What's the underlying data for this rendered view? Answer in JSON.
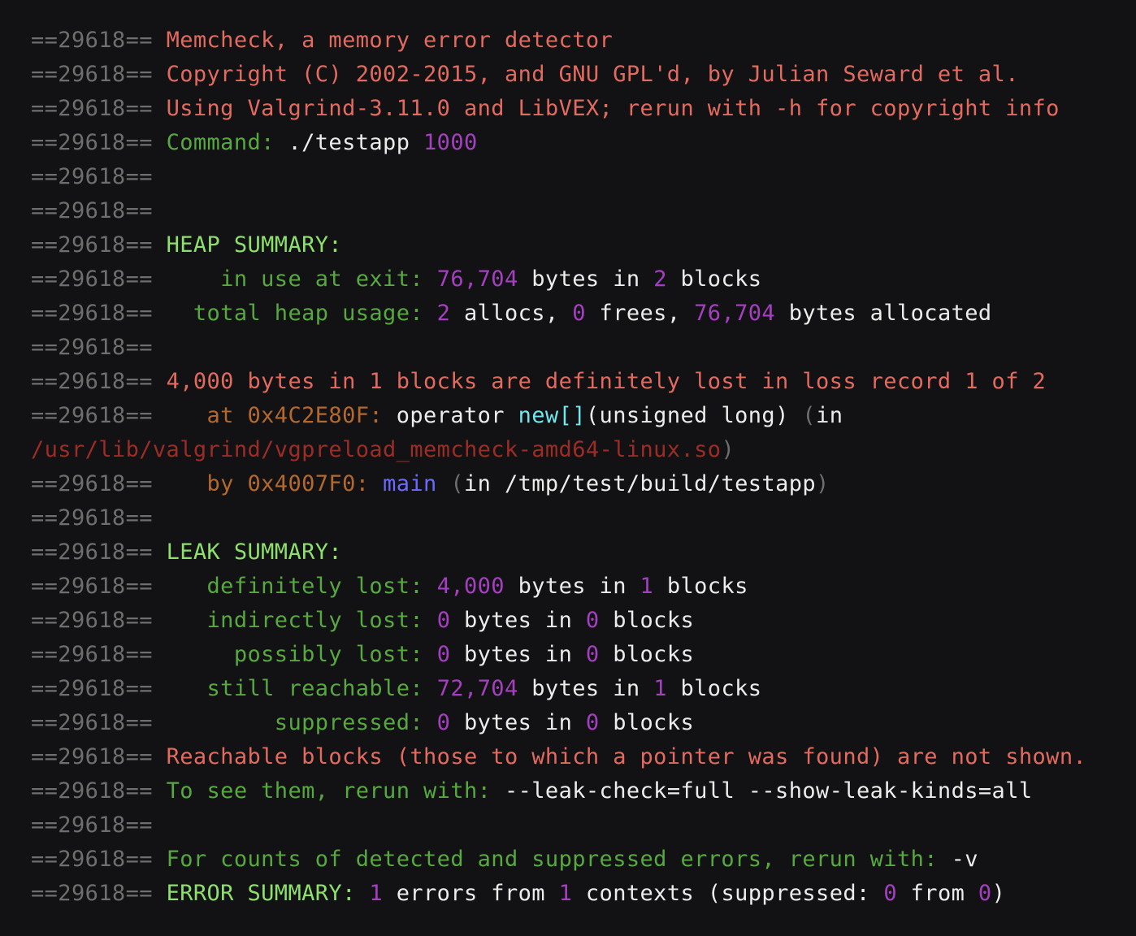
{
  "colors": {
    "background": "#121214",
    "pid": "#6e6e6e",
    "red": "#e26a5e",
    "green": "#56a83f",
    "bgreen": "#8ee06c",
    "purple": "#a43fbf",
    "white": "#ececec",
    "orange": "#b4682c",
    "cyan": "#6fe7ec",
    "blue": "#6a6aff",
    "darkred": "#9e2c26",
    "dim": "#6e6e6e"
  },
  "lines": [
    {
      "name": "line-tool-name",
      "segments": [
        {
          "t": "==29618== ",
          "c": "pid"
        },
        {
          "t": "Memcheck, a memory error detector",
          "c": "red"
        }
      ]
    },
    {
      "name": "line-copyright",
      "segments": [
        {
          "t": "==29618== ",
          "c": "pid"
        },
        {
          "t": "Copyright (C) 2002-2015, and GNU GPL'd, by Julian Seward et al.",
          "c": "red"
        }
      ]
    },
    {
      "name": "line-version",
      "segments": [
        {
          "t": "==29618== ",
          "c": "pid"
        },
        {
          "t": "Using Valgrind-3.11.0 and LibVEX; rerun with -h for copyright info",
          "c": "red"
        }
      ]
    },
    {
      "name": "line-command",
      "segments": [
        {
          "t": "==29618== ",
          "c": "pid"
        },
        {
          "t": "Command: ",
          "c": "green"
        },
        {
          "t": "./testapp ",
          "c": "white"
        },
        {
          "t": "1000",
          "c": "purple"
        }
      ]
    },
    {
      "name": "line-blank",
      "segments": [
        {
          "t": "==29618==",
          "c": "pid"
        }
      ]
    },
    {
      "name": "line-blank",
      "segments": [
        {
          "t": "==29618==",
          "c": "pid"
        }
      ]
    },
    {
      "name": "line-heap-summary-header",
      "segments": [
        {
          "t": "==29618== ",
          "c": "pid"
        },
        {
          "t": "HEAP SUMMARY:",
          "c": "bgreen"
        }
      ]
    },
    {
      "name": "line-in-use-at-exit",
      "segments": [
        {
          "t": "==29618==     ",
          "c": "pid"
        },
        {
          "t": "in use at exit: ",
          "c": "green"
        },
        {
          "t": "76,704",
          "c": "purple"
        },
        {
          "t": " bytes in ",
          "c": "white"
        },
        {
          "t": "2",
          "c": "purple"
        },
        {
          "t": " blocks",
          "c": "white"
        }
      ]
    },
    {
      "name": "line-total-heap-usage",
      "segments": [
        {
          "t": "==29618==   ",
          "c": "pid"
        },
        {
          "t": "total heap usage: ",
          "c": "green"
        },
        {
          "t": "2",
          "c": "purple"
        },
        {
          "t": " allocs, ",
          "c": "white"
        },
        {
          "t": "0",
          "c": "purple"
        },
        {
          "t": " frees, ",
          "c": "white"
        },
        {
          "t": "76,704",
          "c": "purple"
        },
        {
          "t": " bytes allocated",
          "c": "white"
        }
      ]
    },
    {
      "name": "line-blank",
      "segments": [
        {
          "t": "==29618==",
          "c": "pid"
        }
      ]
    },
    {
      "name": "line-loss-record",
      "segments": [
        {
          "t": "==29618== ",
          "c": "pid"
        },
        {
          "t": "4,000 bytes in 1 blocks are definitely lost in loss record 1 of 2",
          "c": "red"
        }
      ]
    },
    {
      "name": "line-stack-frame-1",
      "segments": [
        {
          "t": "==29618==    ",
          "c": "pid"
        },
        {
          "t": "at 0x4C2E80F: ",
          "c": "orange"
        },
        {
          "t": "operator ",
          "c": "white"
        },
        {
          "t": "new[]",
          "c": "cyan"
        },
        {
          "t": "(unsigned long) ",
          "c": "white"
        },
        {
          "t": "(",
          "c": "dim"
        },
        {
          "t": "in",
          "c": "white"
        }
      ]
    },
    {
      "name": "line-stack-frame-1-path",
      "segments": [
        {
          "t": "/usr/lib/valgrind/vgpreload_memcheck-amd64-linux.so",
          "c": "darkred"
        },
        {
          "t": ")",
          "c": "dim"
        }
      ]
    },
    {
      "name": "line-stack-frame-2",
      "segments": [
        {
          "t": "==29618==    ",
          "c": "pid"
        },
        {
          "t": "by 0x4007F0: ",
          "c": "orange"
        },
        {
          "t": "main",
          "c": "blue"
        },
        {
          "t": " ",
          "c": "white"
        },
        {
          "t": "(",
          "c": "dim"
        },
        {
          "t": "in /tmp/test/build/testapp",
          "c": "white"
        },
        {
          "t": ")",
          "c": "dim"
        }
      ]
    },
    {
      "name": "line-blank",
      "segments": [
        {
          "t": "==29618==",
          "c": "pid"
        }
      ]
    },
    {
      "name": "line-leak-summary-header",
      "segments": [
        {
          "t": "==29618== ",
          "c": "pid"
        },
        {
          "t": "LEAK SUMMARY:",
          "c": "bgreen"
        }
      ]
    },
    {
      "name": "line-definitely-lost",
      "segments": [
        {
          "t": "==29618==    ",
          "c": "pid"
        },
        {
          "t": "definitely lost: ",
          "c": "green"
        },
        {
          "t": "4,000",
          "c": "purple"
        },
        {
          "t": " bytes in ",
          "c": "white"
        },
        {
          "t": "1",
          "c": "purple"
        },
        {
          "t": " blocks",
          "c": "white"
        }
      ]
    },
    {
      "name": "line-indirectly-lost",
      "segments": [
        {
          "t": "==29618==    ",
          "c": "pid"
        },
        {
          "t": "indirectly lost: ",
          "c": "green"
        },
        {
          "t": "0",
          "c": "purple"
        },
        {
          "t": " bytes in ",
          "c": "white"
        },
        {
          "t": "0",
          "c": "purple"
        },
        {
          "t": " blocks",
          "c": "white"
        }
      ]
    },
    {
      "name": "line-possibly-lost",
      "segments": [
        {
          "t": "==29618==      ",
          "c": "pid"
        },
        {
          "t": "possibly lost: ",
          "c": "green"
        },
        {
          "t": "0",
          "c": "purple"
        },
        {
          "t": " bytes in ",
          "c": "white"
        },
        {
          "t": "0",
          "c": "purple"
        },
        {
          "t": " blocks",
          "c": "white"
        }
      ]
    },
    {
      "name": "line-still-reachable",
      "segments": [
        {
          "t": "==29618==    ",
          "c": "pid"
        },
        {
          "t": "still reachable: ",
          "c": "green"
        },
        {
          "t": "72,704",
          "c": "purple"
        },
        {
          "t": " bytes in ",
          "c": "white"
        },
        {
          "t": "1",
          "c": "purple"
        },
        {
          "t": " blocks",
          "c": "white"
        }
      ]
    },
    {
      "name": "line-suppressed",
      "segments": [
        {
          "t": "==29618==         ",
          "c": "pid"
        },
        {
          "t": "suppressed: ",
          "c": "green"
        },
        {
          "t": "0",
          "c": "purple"
        },
        {
          "t": " bytes in ",
          "c": "white"
        },
        {
          "t": "0",
          "c": "purple"
        },
        {
          "t": " blocks",
          "c": "white"
        }
      ]
    },
    {
      "name": "line-reachable-note",
      "segments": [
        {
          "t": "==29618== ",
          "c": "pid"
        },
        {
          "t": "Reachable blocks (those to which a pointer was found) are not shown.",
          "c": "red"
        }
      ]
    },
    {
      "name": "line-rerun-hint",
      "segments": [
        {
          "t": "==29618== ",
          "c": "pid"
        },
        {
          "t": "To see them, rerun with: ",
          "c": "green"
        },
        {
          "t": "--leak-check=full --show-leak-kinds=all",
          "c": "white"
        }
      ]
    },
    {
      "name": "line-blank",
      "segments": [
        {
          "t": "==29618==",
          "c": "pid"
        }
      ]
    },
    {
      "name": "line-counts-hint",
      "segments": [
        {
          "t": "==29618== ",
          "c": "pid"
        },
        {
          "t": "For counts of detected and suppressed errors, rerun with: ",
          "c": "green"
        },
        {
          "t": "-v",
          "c": "white"
        }
      ]
    },
    {
      "name": "line-error-summary",
      "segments": [
        {
          "t": "==29618== ",
          "c": "pid"
        },
        {
          "t": "ERROR SUMMARY: ",
          "c": "bgreen"
        },
        {
          "t": "1",
          "c": "purple"
        },
        {
          "t": " errors from ",
          "c": "white"
        },
        {
          "t": "1",
          "c": "purple"
        },
        {
          "t": " contexts (suppressed: ",
          "c": "white"
        },
        {
          "t": "0",
          "c": "purple"
        },
        {
          "t": " from ",
          "c": "white"
        },
        {
          "t": "0",
          "c": "purple"
        },
        {
          "t": ")",
          "c": "white"
        }
      ]
    }
  ]
}
